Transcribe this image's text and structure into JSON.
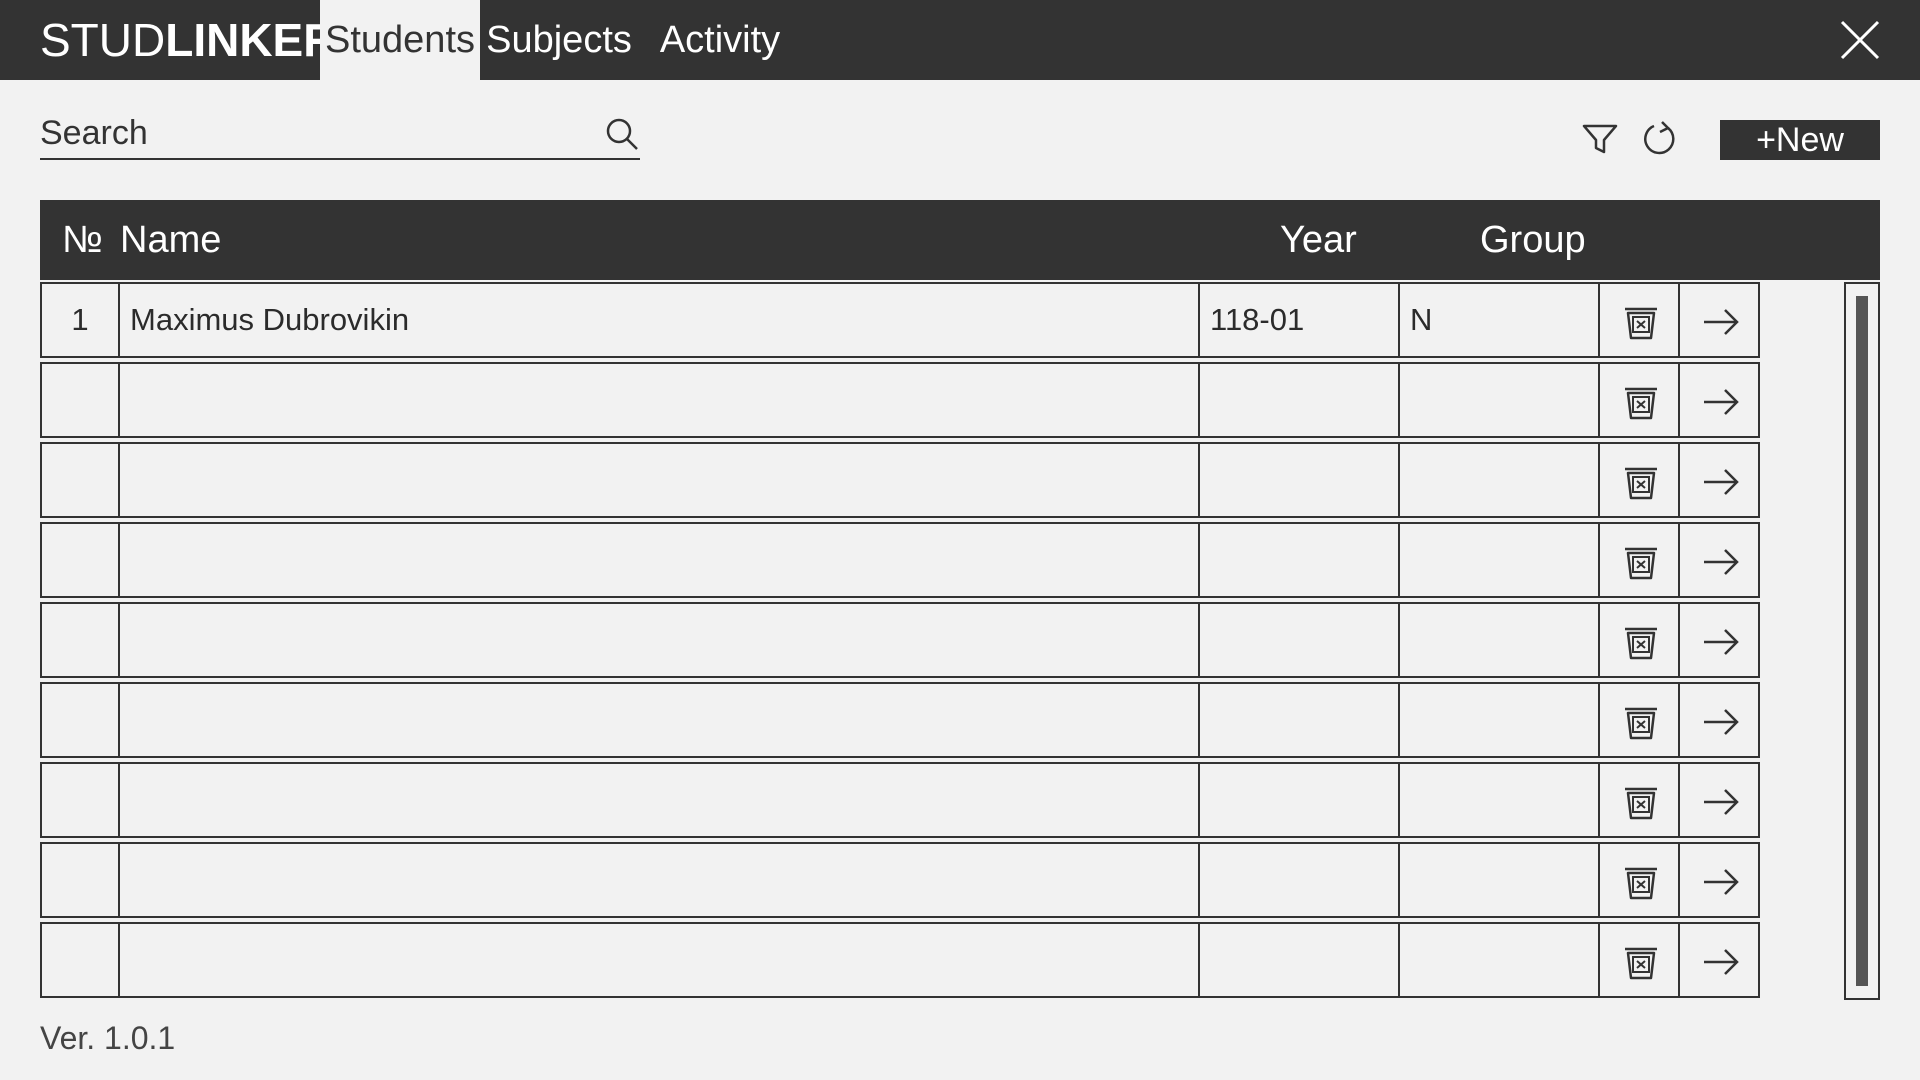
{
  "app": {
    "logo_light": "STUD",
    "logo_bold": "LINKER",
    "version": "Ver. 1.0.1"
  },
  "nav": {
    "tabs": [
      {
        "label": "Students",
        "active": true
      },
      {
        "label": "Subjects",
        "active": false
      },
      {
        "label": "Activity",
        "active": false
      }
    ],
    "close_icon": "close-icon"
  },
  "toolbar": {
    "search_placeholder": "Search",
    "search_value": "",
    "new_label": "+New",
    "icons": [
      "search-icon",
      "filter-icon",
      "refresh-icon"
    ]
  },
  "table": {
    "columns": [
      "№",
      "Name",
      "Year",
      "Group"
    ],
    "rows": [
      {
        "no": "1",
        "name": "Maximus Dubrovikin",
        "year": "118-01",
        "group": "N"
      },
      {
        "no": "",
        "name": "",
        "year": "",
        "group": ""
      },
      {
        "no": "",
        "name": "",
        "year": "",
        "group": ""
      },
      {
        "no": "",
        "name": "",
        "year": "",
        "group": ""
      },
      {
        "no": "",
        "name": "",
        "year": "",
        "group": ""
      },
      {
        "no": "",
        "name": "",
        "year": "",
        "group": ""
      },
      {
        "no": "",
        "name": "",
        "year": "",
        "group": ""
      },
      {
        "no": "",
        "name": "",
        "year": "",
        "group": ""
      },
      {
        "no": "",
        "name": "",
        "year": "",
        "group": ""
      }
    ],
    "row_action_icons": [
      "delete-icon",
      "arrow-right-icon"
    ]
  },
  "colors": {
    "dark": "#333333",
    "background": "#f2f2f2",
    "text": "#2b2b2b"
  }
}
